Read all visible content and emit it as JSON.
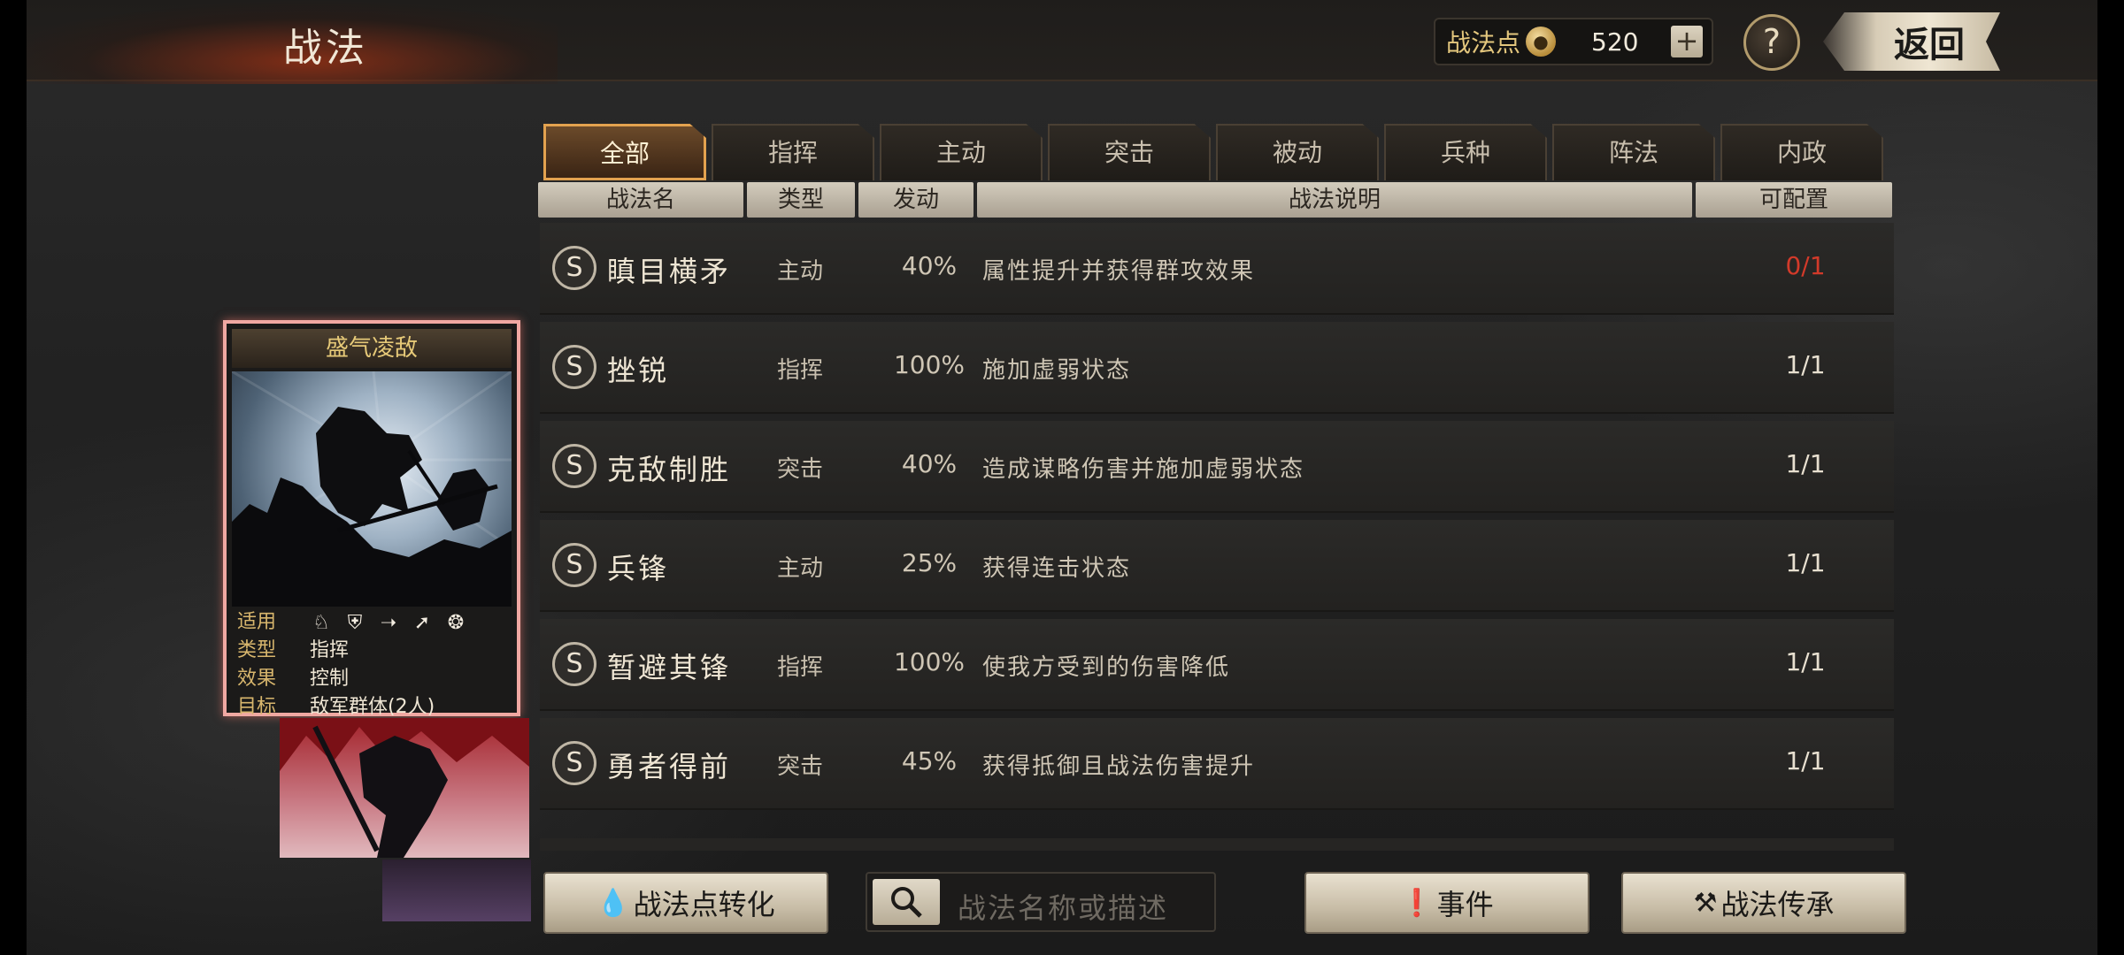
{
  "header": {
    "title": "战法",
    "points_label": "战法点",
    "points_value": "520",
    "plus_label": "+",
    "help_label": "?",
    "back_label": "返回"
  },
  "tabs": [
    {
      "label": "全部",
      "active": true
    },
    {
      "label": "指挥",
      "active": false
    },
    {
      "label": "主动",
      "active": false
    },
    {
      "label": "突击",
      "active": false
    },
    {
      "label": "被动",
      "active": false
    },
    {
      "label": "兵种",
      "active": false
    },
    {
      "label": "阵法",
      "active": false
    },
    {
      "label": "内政",
      "active": false
    }
  ],
  "columns": {
    "name": "战法名",
    "type": "类型",
    "rate": "发动",
    "desc": "战法说明",
    "config": "可配置"
  },
  "rows": [
    {
      "badge": "S",
      "name": "瞋目横矛",
      "type": "主动",
      "rate": "40%",
      "desc": "属性提升并获得群攻效果",
      "config": "0/1",
      "config_color": "#d23a2a"
    },
    {
      "badge": "S",
      "name": "挫锐",
      "type": "指挥",
      "rate": "100%",
      "desc": "施加虚弱状态",
      "config": "1/1"
    },
    {
      "badge": "S",
      "name": "克敌制胜",
      "type": "突击",
      "rate": "40%",
      "desc": "造成谋略伤害并施加虚弱状态",
      "config": "1/1"
    },
    {
      "badge": "S",
      "name": "兵锋",
      "type": "主动",
      "rate": "25%",
      "desc": "获得连击状态",
      "config": "1/1"
    },
    {
      "badge": "S",
      "name": "暂避其锋",
      "type": "指挥",
      "rate": "100%",
      "desc": "使我方受到的伤害降低",
      "config": "1/1"
    },
    {
      "badge": "S",
      "name": "勇者得前",
      "type": "突击",
      "rate": "45%",
      "desc": "获得抵御且战法伤害提升",
      "config": "1/1"
    }
  ],
  "card": {
    "title": "盛气凌敌",
    "apply_key": "适用",
    "apply_icons": [
      "cavalry-icon",
      "shield-icon",
      "bow-icon",
      "spear-icon",
      "wheel-icon"
    ],
    "type_key": "类型",
    "type_val": "指挥",
    "effect_key": "效果",
    "effect_val": "控制",
    "target_key": "目标",
    "target_val": "敌军群体(2人)"
  },
  "bottom": {
    "convert_label": "战法点转化",
    "search_placeholder": "战法名称或描述",
    "event_label": "事件",
    "inherit_label": "战法传承"
  },
  "colors": {
    "accent_gold": "#e3a24f",
    "warning_red": "#d23a2a",
    "card_border": "#f0a8a2"
  }
}
